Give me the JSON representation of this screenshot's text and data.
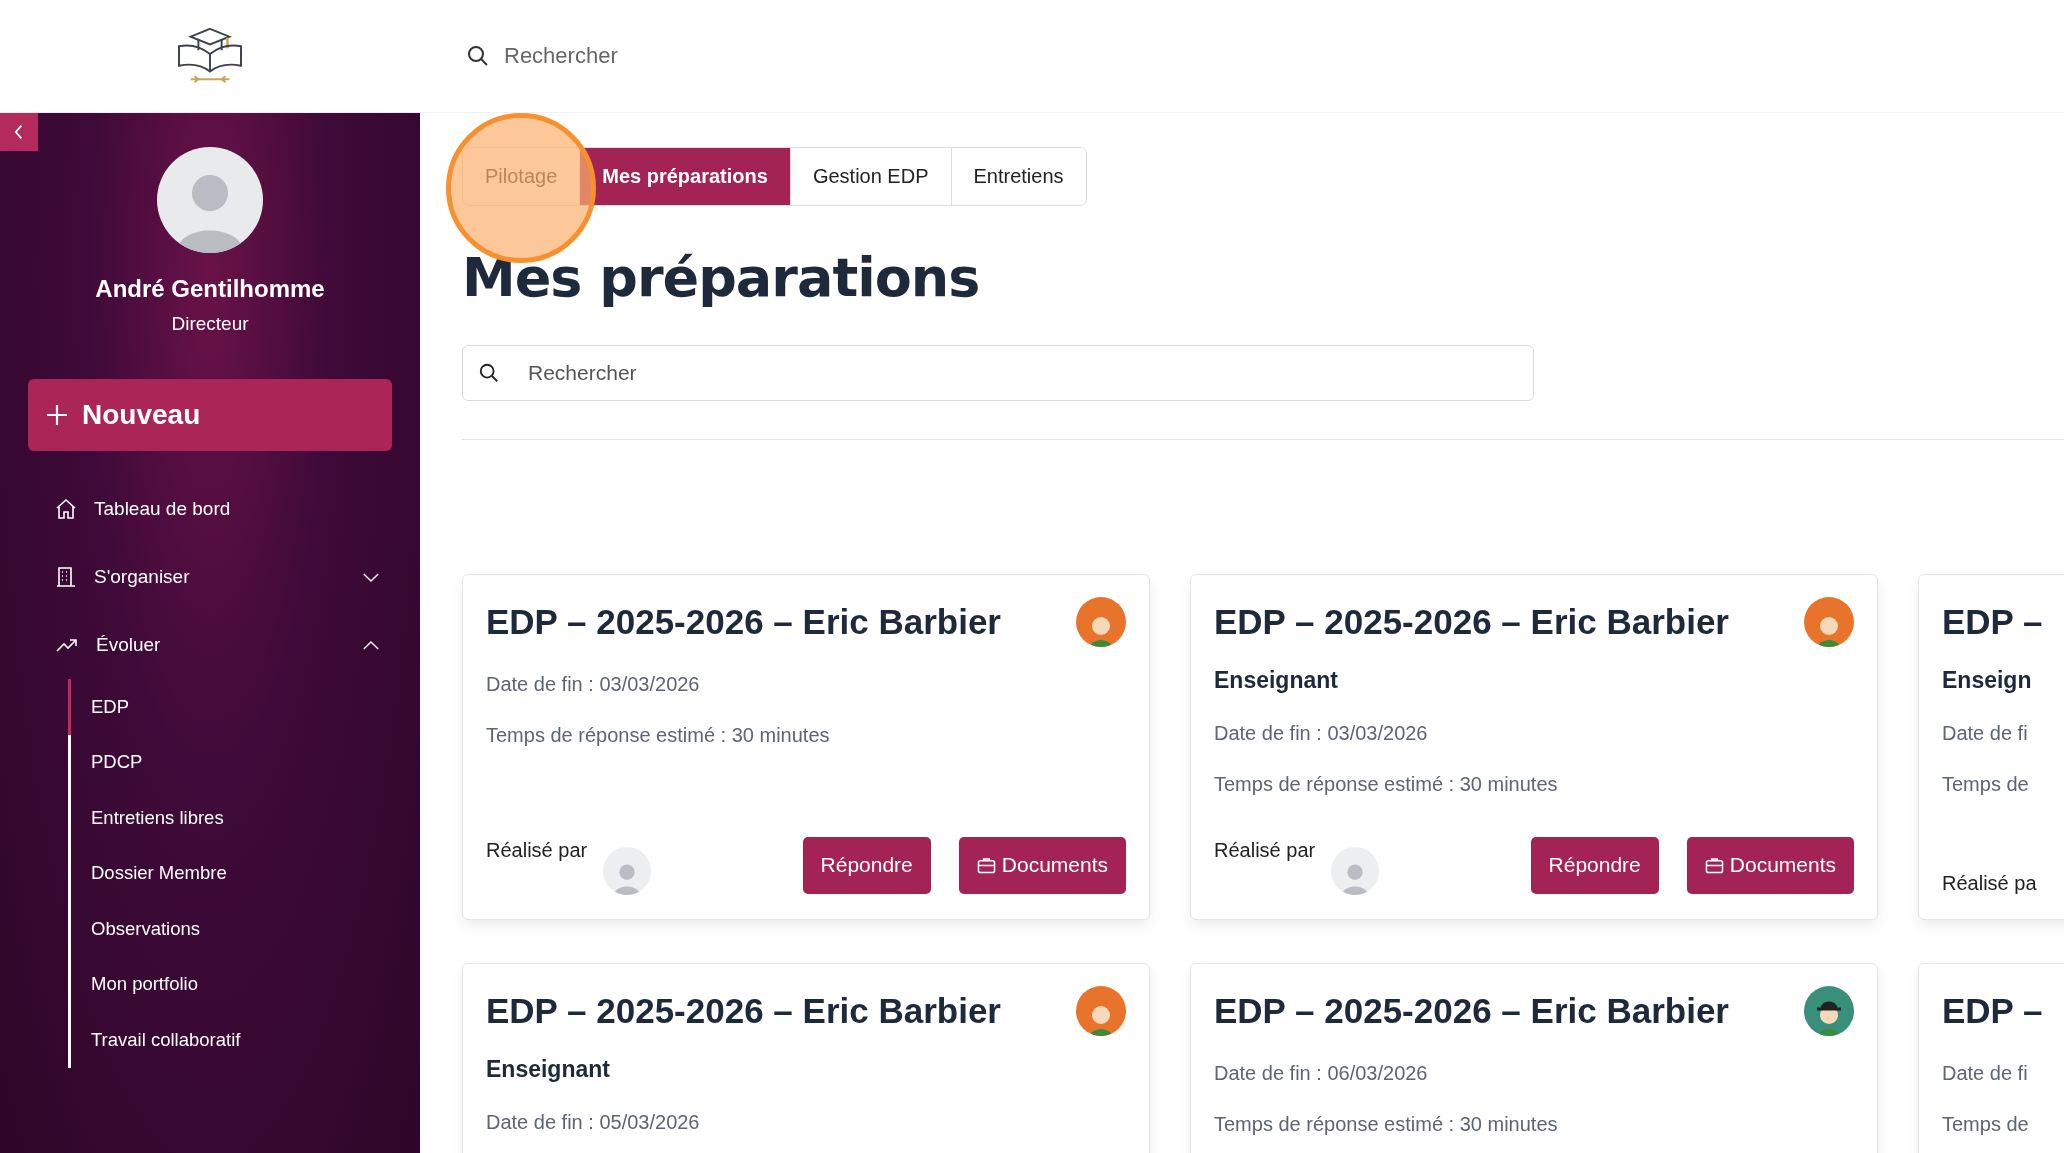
{
  "header": {
    "search": {
      "placeholder": "Rechercher"
    }
  },
  "sidebar": {
    "user": {
      "name": "André Gentilhomme",
      "role": "Directeur"
    },
    "new_button": "Nouveau",
    "items": [
      {
        "kind": "link",
        "label": "Tableau de bord"
      },
      {
        "kind": "group",
        "label": "S'organiser",
        "expanded": false
      },
      {
        "kind": "group",
        "label": "Évoluer",
        "expanded": true,
        "children": [
          {
            "label": "EDP",
            "selected": true
          },
          {
            "label": "PDCP",
            "selected": false
          },
          {
            "label": "Entretiens libres",
            "selected": false
          },
          {
            "label": "Dossier Membre",
            "selected": false
          },
          {
            "label": "Observations",
            "selected": false
          },
          {
            "label": "Mon portfolio",
            "selected": false
          },
          {
            "label": "Travail collaboratif",
            "selected": false
          }
        ]
      }
    ]
  },
  "tabs": [
    {
      "label": "Pilotage",
      "selected": false
    },
    {
      "label": "Mes préparations",
      "selected": true
    },
    {
      "label": "Gestion EDP",
      "selected": false
    },
    {
      "label": "Entretiens",
      "selected": false
    }
  ],
  "page_title": "Mes préparations",
  "search": {
    "placeholder": "Rechercher"
  },
  "cards": [
    {
      "title": "EDP – 2025-2026 – Eric Barbier",
      "date": "Date de fin : 03/03/2026",
      "estimate": "Temps de réponse estimé : 30 minutes",
      "done_by": "Réalisé par",
      "buttons": [
        "Répondre",
        "Documents"
      ]
    },
    {
      "title": "EDP – 2025-2026 – Eric Barbier",
      "role": "Enseignant",
      "date": "Date de fin : 03/03/2026",
      "estimate": "Temps de réponse estimé : 30 minutes",
      "done_by": "Réalisé par",
      "buttons": [
        "Répondre",
        "Documents"
      ]
    },
    {
      "title": "EDP –",
      "role": "Enseign",
      "date": "Date de fi",
      "estimate": "Temps de",
      "done_by": "Réalisé pa"
    },
    {
      "title": "EDP – 2025-2026 – Eric Barbier",
      "role": "Enseignant",
      "date": "Date de fin : 05/03/2026"
    },
    {
      "title": "EDP – 2025-2026 – Eric Barbier",
      "date": "Date de fin : 06/03/2026",
      "estimate": "Temps de réponse estimé : 30 minutes"
    },
    {
      "title": "EDP –",
      "date": "Date de fi",
      "estimate": "Temps de"
    }
  ]
}
